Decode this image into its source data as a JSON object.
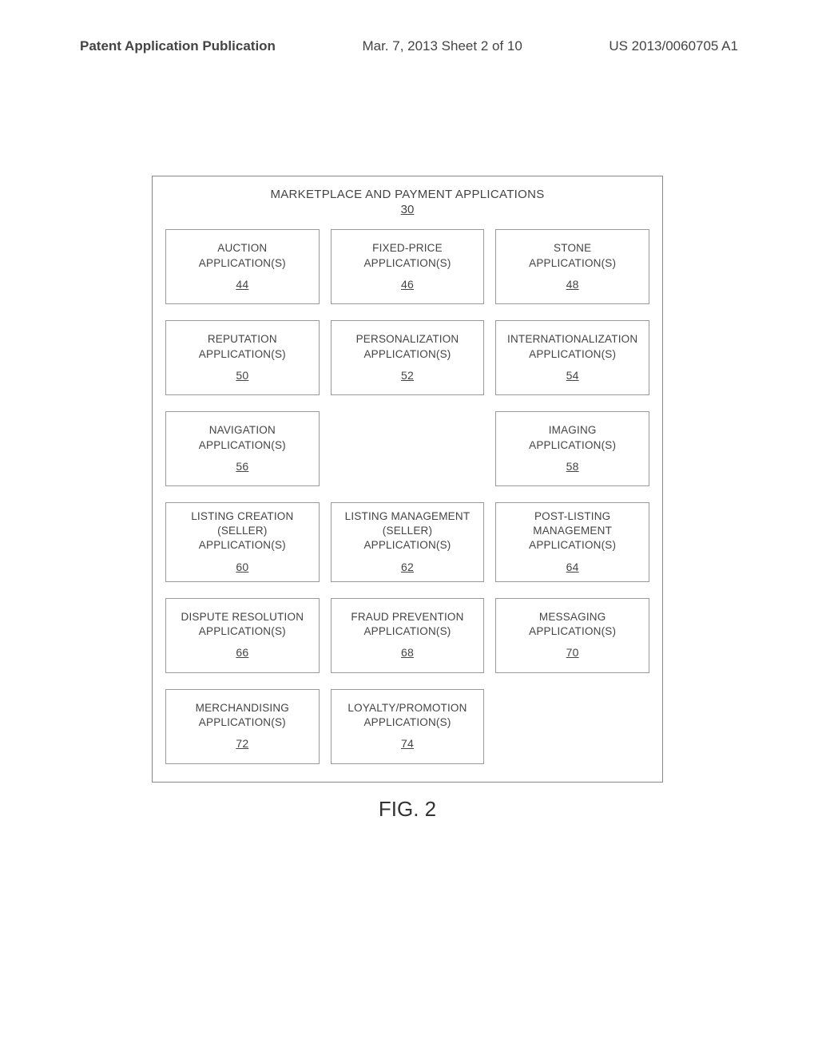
{
  "header": {
    "left": "Patent Application Publication",
    "mid": "Mar. 7, 2013  Sheet 2 of 10",
    "right": "US 2013/0060705 A1"
  },
  "diagram": {
    "title": "MARKETPLACE AND PAYMENT APPLICATIONS",
    "ref": "30",
    "figure_label": "FIG. 2",
    "cells": [
      {
        "lines": "AUCTION\nAPPLICATION(S)",
        "ref": "44"
      },
      {
        "lines": "FIXED-PRICE\nAPPLICATION(S)",
        "ref": "46"
      },
      {
        "lines": "STONE\nAPPLICATION(S)",
        "ref": "48"
      },
      {
        "lines": "REPUTATION\nAPPLICATION(S)",
        "ref": "50"
      },
      {
        "lines": "PERSONALIZATION\nAPPLICATION(S)",
        "ref": "52"
      },
      {
        "lines": "INTERNATIONALIZATION\nAPPLICATION(S)",
        "ref": "54"
      },
      {
        "lines": "NAVIGATION\nAPPLICATION(S)",
        "ref": "56"
      },
      {
        "empty": true
      },
      {
        "lines": "IMAGING\nAPPLICATION(S)",
        "ref": "58"
      },
      {
        "lines": "LISTING CREATION\n(SELLER)\nAPPLICATION(S)",
        "ref": "60"
      },
      {
        "lines": "LISTING MANAGEMENT\n(SELLER)\nAPPLICATION(S)",
        "ref": "62"
      },
      {
        "lines": "POST-LISTING\nMANAGEMENT\nAPPLICATION(S)",
        "ref": "64"
      },
      {
        "lines": "DISPUTE RESOLUTION\nAPPLICATION(S)",
        "ref": "66"
      },
      {
        "lines": "FRAUD PREVENTION\nAPPLICATION(S)",
        "ref": "68"
      },
      {
        "lines": "MESSAGING\nAPPLICATION(S)",
        "ref": "70"
      },
      {
        "lines": "MERCHANDISING\nAPPLICATION(S)",
        "ref": "72"
      },
      {
        "lines": "LOYALTY/PROMOTION\nAPPLICATION(S)",
        "ref": "74"
      },
      {
        "empty": true
      }
    ]
  }
}
